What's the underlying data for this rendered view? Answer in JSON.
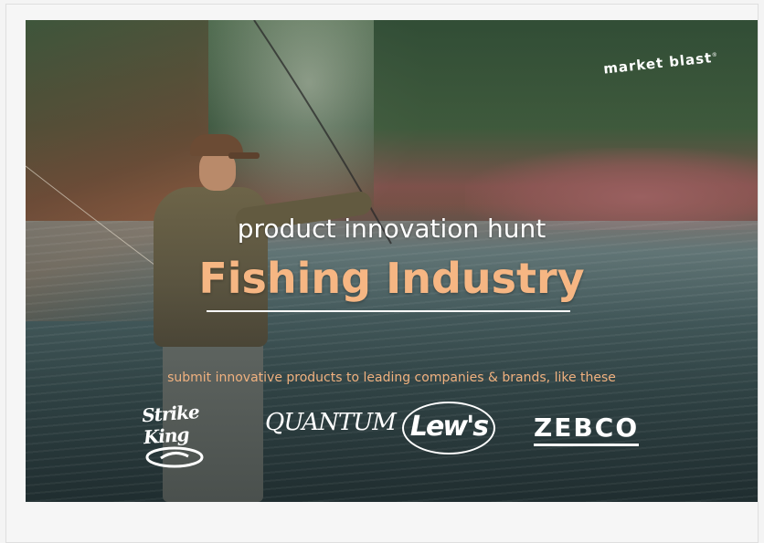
{
  "banner": {
    "logo": "market blast",
    "logo_mark": "®",
    "subtitle": "product innovation hunt",
    "title": "Fishing Industry",
    "tagline": "submit innovative products to leading companies & brands, like these",
    "brands": [
      {
        "name": "Strike King",
        "icon": "strike-king-logo"
      },
      {
        "name": "QUANTUM",
        "icon": "quantum-logo"
      },
      {
        "name": "Lew's",
        "icon": "lews-logo"
      },
      {
        "name": "ZEBCO",
        "icon": "zebco-logo"
      }
    ],
    "colors": {
      "title": "#f6b683",
      "tagline": "#f0b17f",
      "subtitle": "#ffffff"
    }
  }
}
